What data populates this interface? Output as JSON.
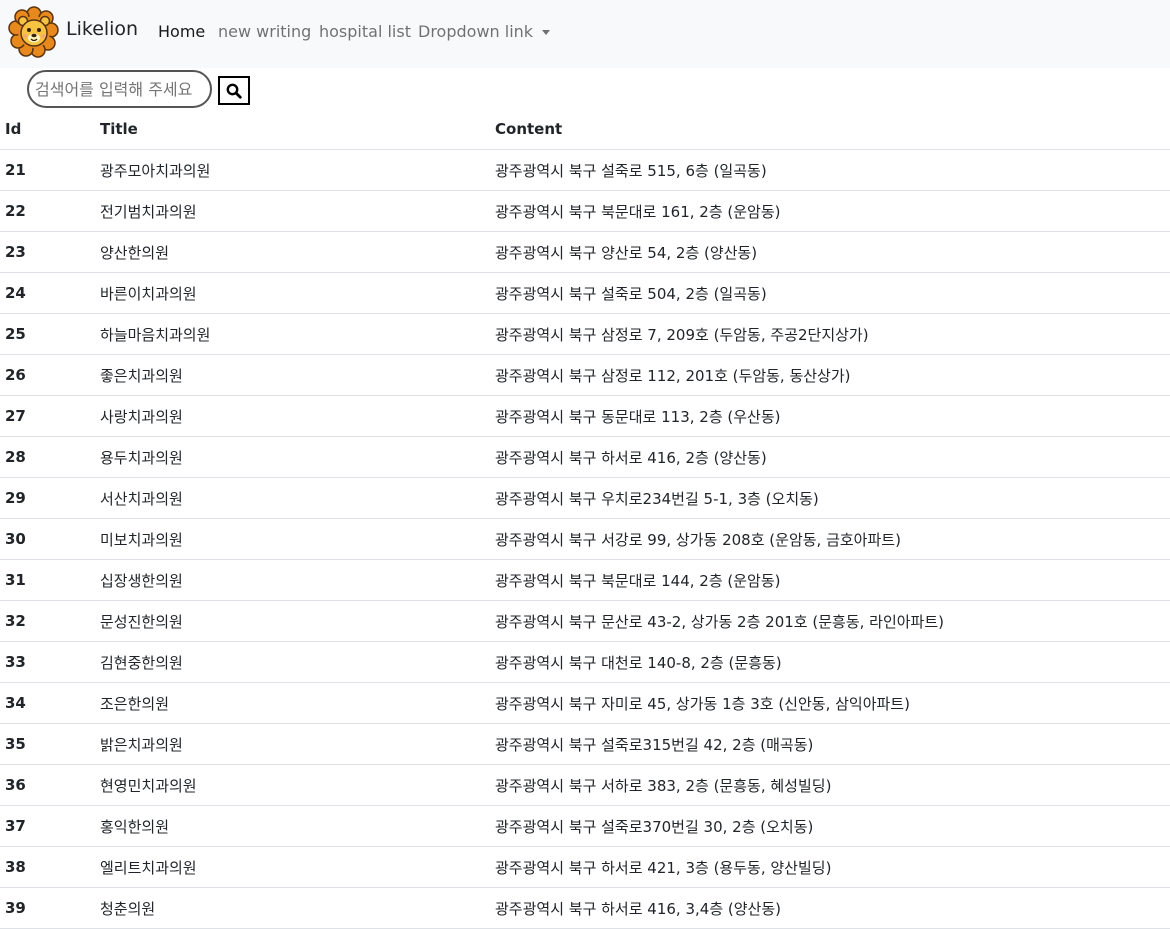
{
  "navbar": {
    "brand": "Likelion",
    "links": [
      {
        "label": "Home"
      },
      {
        "label": "new writing"
      },
      {
        "label": "hospital list"
      },
      {
        "label": "Dropdown link"
      }
    ]
  },
  "search": {
    "placeholder": "검색어를 입력해 주세요",
    "icon": "search-icon"
  },
  "table": {
    "headers": [
      "Id",
      "Title",
      "Content"
    ],
    "rows": [
      {
        "id": "21",
        "title": "광주모아치과의원",
        "content": "광주광역시 북구 설죽로 515, 6층 (일곡동)"
      },
      {
        "id": "22",
        "title": "전기범치과의원",
        "content": "광주광역시 북구 북문대로 161, 2층 (운암동)"
      },
      {
        "id": "23",
        "title": "양산한의원",
        "content": "광주광역시 북구 양산로 54, 2층 (양산동)"
      },
      {
        "id": "24",
        "title": "바른이치과의원",
        "content": "광주광역시 북구 설죽로 504, 2층 (일곡동)"
      },
      {
        "id": "25",
        "title": "하늘마음치과의원",
        "content": "광주광역시 북구 삼정로 7, 209호 (두암동, 주공2단지상가)"
      },
      {
        "id": "26",
        "title": "좋은치과의원",
        "content": "광주광역시 북구 삼정로 112, 201호 (두암동, 동산상가)"
      },
      {
        "id": "27",
        "title": "사랑치과의원",
        "content": "광주광역시 북구 동문대로 113, 2층 (우산동)"
      },
      {
        "id": "28",
        "title": "용두치과의원",
        "content": "광주광역시 북구 하서로 416, 2층 (양산동)"
      },
      {
        "id": "29",
        "title": "서산치과의원",
        "content": "광주광역시 북구 우치로234번길 5-1, 3층 (오치동)"
      },
      {
        "id": "30",
        "title": "미보치과의원",
        "content": "광주광역시 북구 서강로 99, 상가동 208호 (운암동, 금호아파트)"
      },
      {
        "id": "31",
        "title": "십장생한의원",
        "content": "광주광역시 북구 북문대로 144, 2층 (운암동)"
      },
      {
        "id": "32",
        "title": "문성진한의원",
        "content": "광주광역시 북구 문산로 43-2, 상가동 2층 201호 (문흥동, 라인아파트)"
      },
      {
        "id": "33",
        "title": "김현중한의원",
        "content": "광주광역시 북구 대천로 140-8, 2층 (문흥동)"
      },
      {
        "id": "34",
        "title": "조은한의원",
        "content": "광주광역시 북구 자미로 45, 상가동 1층 3호 (신안동, 삼익아파트)"
      },
      {
        "id": "35",
        "title": "밝은치과의원",
        "content": "광주광역시 북구 설죽로315번길 42, 2층 (매곡동)"
      },
      {
        "id": "36",
        "title": "현영민치과의원",
        "content": "광주광역시 북구 서하로 383, 2층 (문흥동, 혜성빌딩)"
      },
      {
        "id": "37",
        "title": "홍익한의원",
        "content": "광주광역시 북구 설죽로370번길 30, 2층 (오치동)"
      },
      {
        "id": "38",
        "title": "엘리트치과의원",
        "content": "광주광역시 북구 하서로 421, 3층 (용두동, 양산빌딩)"
      },
      {
        "id": "39",
        "title": "청춘의원",
        "content": "광주광역시 북구 하서로 416, 3,4층 (양산동)"
      }
    ]
  }
}
